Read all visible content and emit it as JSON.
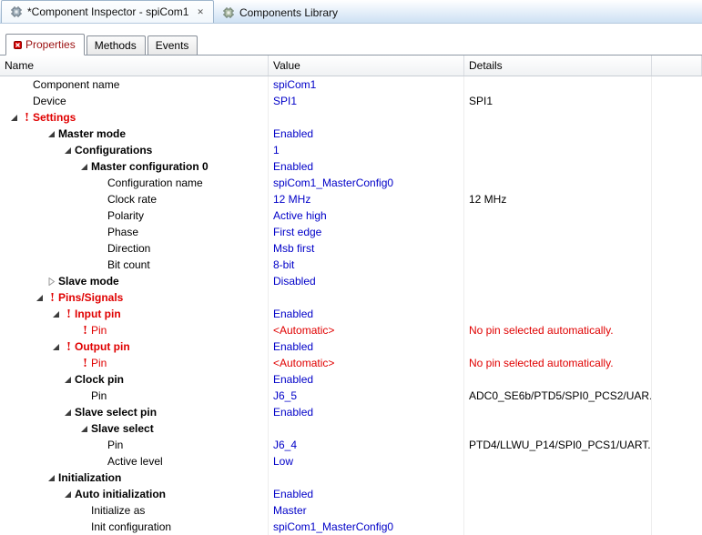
{
  "editor_tabs": [
    {
      "label": "*Component Inspector - spiCom1",
      "active": true,
      "closable": true
    },
    {
      "label": "Components Library",
      "active": false
    }
  ],
  "view_tabs": {
    "properties": "Properties",
    "methods": "Methods",
    "events": "Events"
  },
  "table": {
    "columns": {
      "name": "Name",
      "value": "Value",
      "details": "Details"
    },
    "rows": [
      {
        "label": "Component name",
        "level": 1,
        "value": "spiCom1"
      },
      {
        "label": "Device",
        "level": 1,
        "value": "SPI1",
        "details": "SPI1"
      },
      {
        "label": "Settings",
        "level": 1,
        "exp": "open",
        "error": true,
        "bold": true,
        "red": true
      },
      {
        "label": "Master mode",
        "level": 2,
        "exp": "open",
        "bold": true,
        "value": "Enabled"
      },
      {
        "label": "Configurations",
        "level": 3,
        "exp": "open",
        "bold": true,
        "value": "1"
      },
      {
        "label": "Master configuration 0",
        "level": 4,
        "exp": "open",
        "bold": true,
        "value": "Enabled"
      },
      {
        "label": "Configuration name",
        "level": 5,
        "value": "spiCom1_MasterConfig0"
      },
      {
        "label": "Clock rate",
        "level": 5,
        "value": "12 MHz",
        "details": "12 MHz"
      },
      {
        "label": "Polarity",
        "level": 5,
        "value": "Active high"
      },
      {
        "label": "Phase",
        "level": 5,
        "value": "First edge"
      },
      {
        "label": "Direction",
        "level": 5,
        "value": "Msb first"
      },
      {
        "label": "Bit count",
        "level": 5,
        "value": "8-bit"
      },
      {
        "label": "Slave mode",
        "level": 2,
        "exp": "closed",
        "bold": true,
        "value": "Disabled"
      },
      {
        "label": "Pins/Signals",
        "level": 2,
        "exp": "open",
        "error": true,
        "bold": true,
        "red": true
      },
      {
        "label": "Input pin",
        "level": 3,
        "exp": "open",
        "error": true,
        "bold": true,
        "red": true,
        "value": "Enabled"
      },
      {
        "label": "Pin",
        "level": 4,
        "error": true,
        "red": true,
        "value": "<Automatic>",
        "value_red": true,
        "details": "No pin selected automatically.",
        "details_red": true
      },
      {
        "label": "Output pin",
        "level": 3,
        "exp": "open",
        "error": true,
        "bold": true,
        "red": true,
        "value": "Enabled"
      },
      {
        "label": "Pin",
        "level": 4,
        "error": true,
        "red": true,
        "value": "<Automatic>",
        "value_red": true,
        "details": "No pin selected automatically.",
        "details_red": true
      },
      {
        "label": "Clock pin",
        "level": 3,
        "exp": "open",
        "bold": true,
        "value": "Enabled"
      },
      {
        "label": "Pin",
        "level": 4,
        "value": "J6_5",
        "details": "ADC0_SE6b/PTD5/SPI0_PCS2/UAR..."
      },
      {
        "label": "Slave select pin",
        "level": 3,
        "exp": "open",
        "bold": true,
        "value": "Enabled"
      },
      {
        "label": "Slave select",
        "level": 4,
        "exp": "open",
        "bold": true
      },
      {
        "label": "Pin",
        "level": 5,
        "value": "J6_4",
        "details": "PTD4/LLWU_P14/SPI0_PCS1/UART..."
      },
      {
        "label": "Active level",
        "level": 5,
        "value": "Low"
      },
      {
        "label": "Initialization",
        "level": 2,
        "exp": "open",
        "bold": true
      },
      {
        "label": "Auto initialization",
        "level": 3,
        "exp": "open",
        "bold": true,
        "value": "Enabled"
      },
      {
        "label": "Initialize as",
        "level": 4,
        "value": "Master"
      },
      {
        "label": "Init configuration",
        "level": 4,
        "value": "spiCom1_MasterConfig0"
      }
    ]
  },
  "colors": {
    "value_text": "#0000c8",
    "error_text": "#e00000",
    "tabbar_gradient_top": "#ffffff",
    "tabbar_gradient_bottom": "#cfe1f3",
    "properties_tab_text": "#9c1010"
  },
  "icons": {
    "tab_icon": "component-chip-icon",
    "properties_tab_icon": "error-overlay-icon",
    "expander_open": "expander-open-icon",
    "expander_closed": "expander-closed-icon",
    "error_marker": "error-icon",
    "close": "close-icon"
  }
}
